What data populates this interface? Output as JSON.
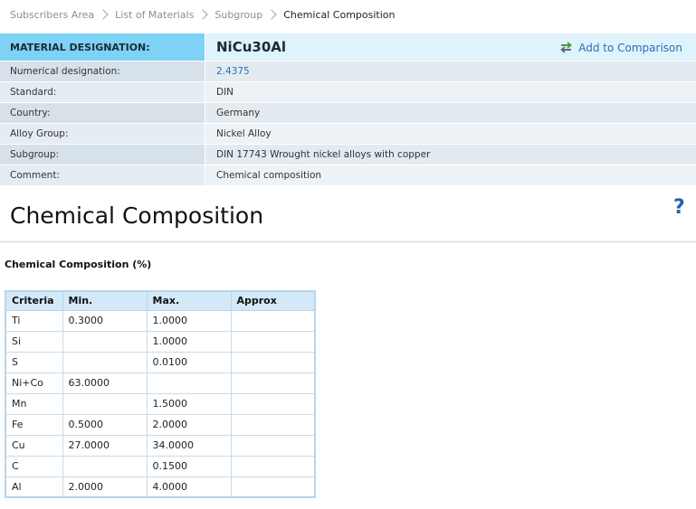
{
  "breadcrumb": {
    "items": [
      "Subscribers Area",
      "List of Materials",
      "Subgroup"
    ],
    "current": "Chemical Composition"
  },
  "material": {
    "label": "MATERIAL DESIGNATION:",
    "name": "NiCu30Al",
    "compare_label": "Add to Comparison",
    "rows": [
      {
        "label": "Numerical designation:",
        "value": "2.4375"
      },
      {
        "label": "Standard:",
        "value": "DIN"
      },
      {
        "label": "Country:",
        "value": "Germany"
      },
      {
        "label": "Alloy Group:",
        "value": "Nickel Alloy"
      },
      {
        "label": "Subgroup:",
        "value": "DIN 17743 Wrought nickel alloys with copper"
      },
      {
        "label": "Comment:",
        "value": "Chemical composition"
      }
    ]
  },
  "section": {
    "title": "Chemical Composition",
    "help": "?",
    "subtitle": "Chemical Composition (%)"
  },
  "composition": {
    "headers": [
      "Criteria",
      "Min.",
      "Max.",
      "Approx"
    ],
    "rows": [
      [
        "Ti",
        "0.3000",
        "1.0000",
        ""
      ],
      [
        "Si",
        "",
        "1.0000",
        ""
      ],
      [
        "S",
        "",
        "0.0100",
        ""
      ],
      [
        "Ni+Co",
        "63.0000",
        "",
        ""
      ],
      [
        "Mn",
        "",
        "1.5000",
        ""
      ],
      [
        "Fe",
        "0.5000",
        "2.0000",
        ""
      ],
      [
        "Cu",
        "27.0000",
        "34.0000",
        ""
      ],
      [
        "C",
        "",
        "0.1500",
        ""
      ],
      [
        "Al",
        "2.0000",
        "4.0000",
        ""
      ]
    ]
  },
  "colors": {
    "link": "#2a6fb6",
    "header_accent": "#7dd2f5",
    "table_header": "#d4e9f8"
  },
  "icons": {
    "separator": "chevron-right-icon",
    "compare": "swap-arrows-icon",
    "help": "help-icon"
  }
}
